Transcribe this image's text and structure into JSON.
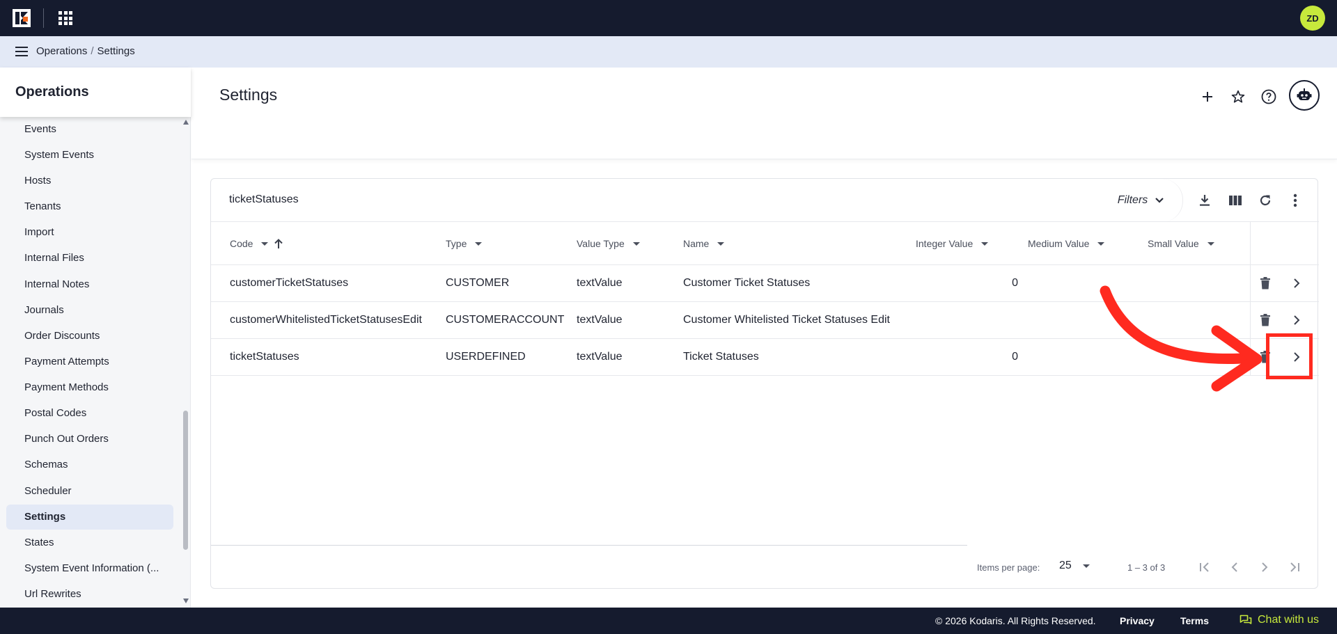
{
  "topbar": {
    "avatar_initials": "ZD",
    "accent": "#c7e93c",
    "background": "#151b2e"
  },
  "breadcrumb": {
    "parent": "Operations",
    "current": "Settings"
  },
  "sidebar": {
    "title": "Operations",
    "items": [
      "Events",
      "System Events",
      "Hosts",
      "Tenants",
      "Import",
      "Internal Files",
      "Internal Notes",
      "Journals",
      "Order Discounts",
      "Payment Attempts",
      "Payment Methods",
      "Postal Codes",
      "Punch Out Orders",
      "Schemas",
      "Scheduler",
      "Settings",
      "States",
      "System Event Information (...",
      "Url Rewrites"
    ],
    "active_item": "Settings"
  },
  "page": {
    "title": "Settings"
  },
  "card": {
    "title": "ticketStatuses",
    "filters_label": "Filters",
    "columns": {
      "code": "Code",
      "type": "Type",
      "value_type": "Value Type",
      "name": "Name",
      "integer_value": "Integer Value",
      "medium_value": "Medium Value",
      "small_value": "Small Value"
    },
    "rows": [
      {
        "code": "customerTicketStatuses",
        "type": "CUSTOMER",
        "value_type": "textValue",
        "name": "Customer Ticket Statuses",
        "integer_value": "0"
      },
      {
        "code": "customerWhitelistedTicketStatusesEdit",
        "type": "CUSTOMERACCOUNT",
        "value_type": "textValue",
        "name": "Customer Whitelisted Ticket Statuses Edit",
        "integer_value": ""
      },
      {
        "code": "ticketStatuses",
        "type": "USERDEFINED",
        "value_type": "textValue",
        "name": "Ticket Statuses",
        "integer_value": "0"
      }
    ],
    "pager": {
      "items_per_page_label": "Items per page:",
      "page_size": "25",
      "range": "1 – 3 of 3"
    }
  },
  "footer": {
    "copyright": "© 2026 Kodaris. All Rights Reserved.",
    "privacy": "Privacy",
    "terms": "Terms",
    "chat": "Chat with us"
  },
  "annotation": {
    "color": "#ff2a1f"
  }
}
